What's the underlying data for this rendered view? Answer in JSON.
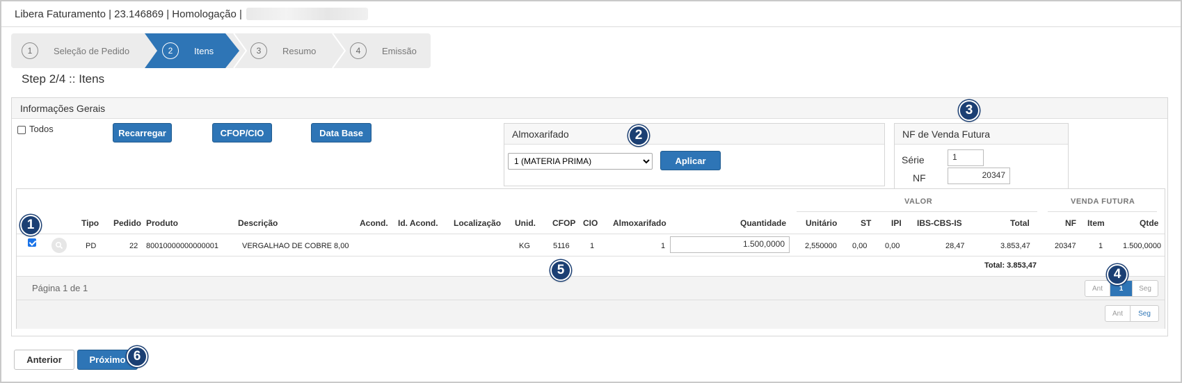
{
  "window": {
    "title": "Libera Faturamento | 23.146869 | Homologação |"
  },
  "wizard": {
    "steps": [
      {
        "num": "1",
        "label": "Seleção de Pedido"
      },
      {
        "num": "2",
        "label": "Itens"
      },
      {
        "num": "3",
        "label": "Resumo"
      },
      {
        "num": "4",
        "label": "Emissão"
      }
    ],
    "active_index": 2,
    "subtitle": "Step 2/4 :: Itens"
  },
  "panel": {
    "title": "Informações Gerais",
    "todos_label": "Todos",
    "buttons": {
      "recarregar": "Recarregar",
      "cfop": "CFOP/CIO",
      "data_base": "Data Base"
    }
  },
  "almoxarifado": {
    "title": "Almoxarifado",
    "selected": "1 (MATERIA PRIMA)",
    "apply_label": "Aplicar"
  },
  "nf_venda_futura": {
    "title": "NF de Venda Futura",
    "serie_label": "Série",
    "serie_value": "1",
    "nf_label": "NF",
    "nf_value": "20347"
  },
  "grid": {
    "groups": {
      "valor": "VALOR",
      "venda_futura": "VENDA FUTURA"
    },
    "headers": {
      "tipo": "Tipo",
      "pedido": "Pedido",
      "produto": "Produto",
      "descricao": "Descrição",
      "acond": "Acond.",
      "id_acond": "Id. Acond.",
      "localizacao": "Localização",
      "unid": "Unid.",
      "cfop": "CFOP",
      "cio": "CIO",
      "almoxarifado": "Almoxarifado",
      "quantidade": "Quantidade",
      "unitario": "Unitário",
      "st": "ST",
      "ipi": "IPI",
      "ibs": "IBS-CBS-IS",
      "total": "Total",
      "nf": "NF",
      "item": "Item",
      "qtde": "Qtde"
    },
    "rows": [
      {
        "checked": true,
        "tipo": "PD",
        "pedido": "22",
        "produto": "80010000000000001",
        "descricao": "VERGALHAO DE COBRE 8,00",
        "unid": "KG",
        "cfop": "5116",
        "cio": "1",
        "almoxarifado": "1",
        "quantidade": "1.500,0000",
        "unitario": "2,550000",
        "st": "0,00",
        "ipi": "0,00",
        "ibs": "28,47",
        "total": "3.853,47",
        "nf": "20347",
        "item": "1",
        "qtde": "1.500,0000"
      }
    ],
    "total_label": "Total: 3.853,47",
    "page_info": "Página 1 de 1",
    "pager": {
      "prev": "Ant",
      "current": "1",
      "next": "Seg"
    }
  },
  "footer": {
    "anterior": "Anterior",
    "proximo": "Próximo"
  },
  "callouts": [
    "1",
    "2",
    "3",
    "4",
    "5",
    "6"
  ],
  "colors": {
    "accent": "#2e75b6",
    "callout": "#1b3f73"
  }
}
